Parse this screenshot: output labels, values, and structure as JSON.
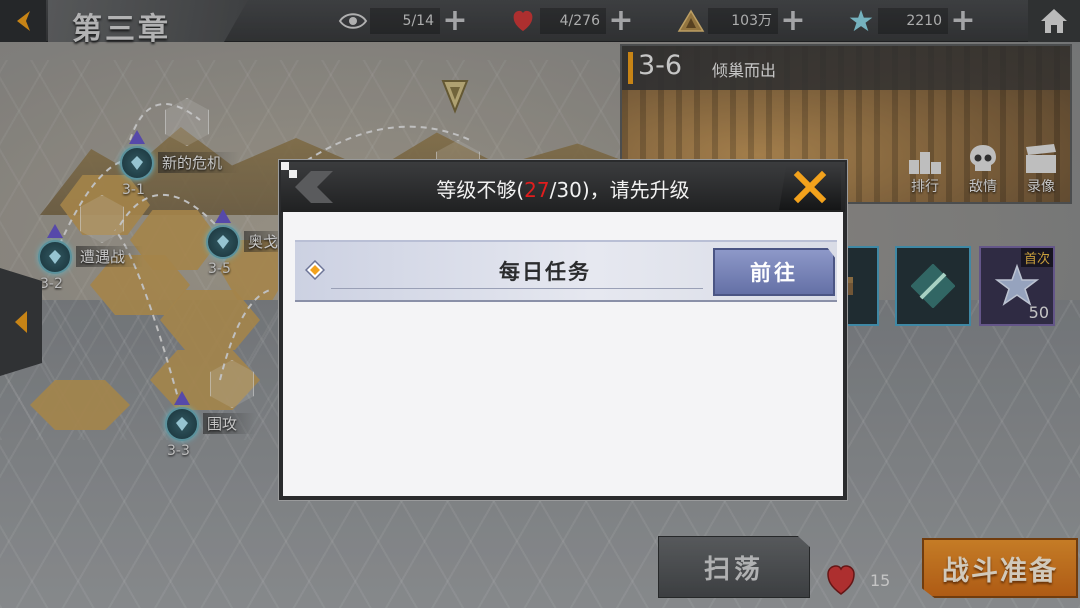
{
  "header": {
    "chapter_title": "第三章",
    "resources": [
      {
        "icon": "eye-icon",
        "value": "5/14"
      },
      {
        "icon": "heart-stamina-icon",
        "value": "4/276"
      },
      {
        "icon": "triangle-emblem-icon",
        "value": "103万"
      },
      {
        "icon": "crystal-star-icon",
        "value": "2210"
      }
    ]
  },
  "map": {
    "nodes": [
      {
        "label": "新的危机",
        "code": "3-1"
      },
      {
        "label": "遭遇战",
        "code": "3-2"
      },
      {
        "label": "围攻",
        "code": "3-3"
      },
      {
        "label": "奥戈",
        "code": "3-5"
      }
    ]
  },
  "stage_card": {
    "number": "3-6",
    "name": "倾巢而出",
    "buttons": [
      {
        "icon": "podium-icon",
        "label": "排行"
      },
      {
        "icon": "skull-icon",
        "label": "敌情"
      },
      {
        "icon": "clapperboard-icon",
        "label": "录像"
      }
    ]
  },
  "rewards": {
    "first_clear_badge": "首次",
    "first_clear_count": "50"
  },
  "bottom": {
    "sweep_label": "扫荡",
    "stamina_cost": "15",
    "battle_label": "战斗准备"
  },
  "dialog": {
    "title_prefix": "等级不够(",
    "current_level": "27",
    "title_suffix": "/30)，请先升级",
    "task_name": "每日任务",
    "go_label": "前往"
  },
  "colors": {
    "accent_orange": "#f3a21c",
    "warning_red": "#e11d1d",
    "go_button": "#7a84b8"
  }
}
